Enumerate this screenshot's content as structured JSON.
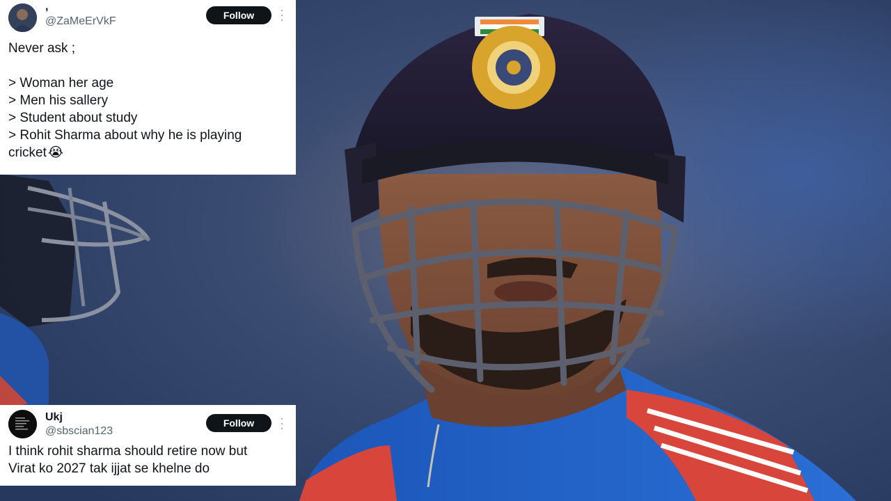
{
  "tweets": [
    {
      "display_name": ",",
      "handle": "@ZaMeErVkF",
      "follow_label": "Follow",
      "lines": [
        "Never ask ;",
        "",
        "> Woman her age",
        "> Men his sallery",
        "> Student about study",
        "> Rohit Sharma about why he is playing",
        "cricket"
      ],
      "emoji": "😭"
    },
    {
      "display_name": "Ukj",
      "handle": "@sbscian123",
      "follow_label": "Follow",
      "lines": [
        "I think rohit sharma should retire now but",
        "Virat ko 2027 tak ijjat se khelne do"
      ]
    }
  ],
  "colors": {
    "button_bg": "#0f1419",
    "handle_gray": "#536471",
    "tweet_bg": "#ffffff"
  },
  "icons": {
    "more": "more-vertical-icon",
    "helmet_flag": "indian-flag-icon",
    "helmet_crest": "bcci-crest-icon"
  }
}
